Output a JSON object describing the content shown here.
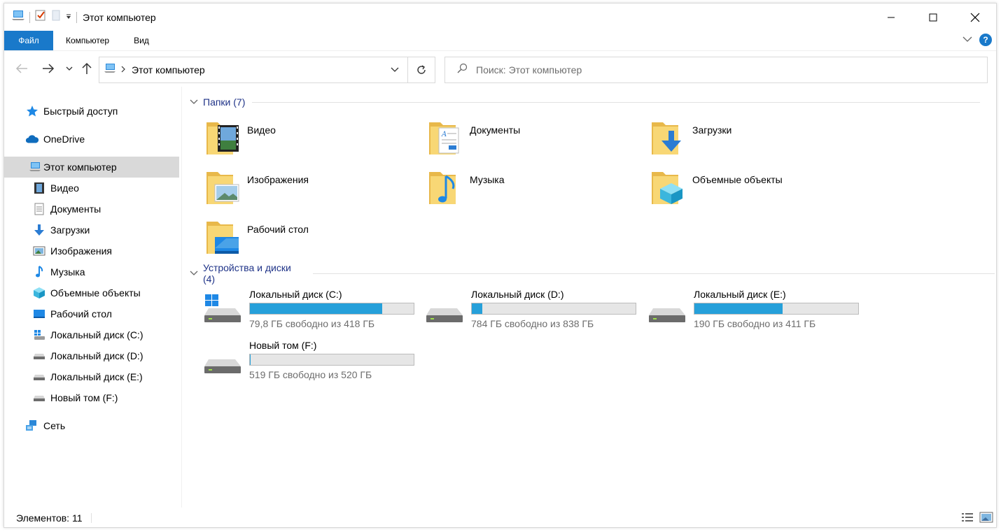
{
  "window": {
    "title": "Этот компьютер",
    "minimize_icon": "minimize-icon",
    "maximize_icon": "maximize-icon",
    "close_icon": "close-icon"
  },
  "ribbon": {
    "tabs": [
      {
        "label": "Файл",
        "active": true
      },
      {
        "label": "Компьютер"
      },
      {
        "label": "Вид"
      }
    ],
    "accent": "#1979ca"
  },
  "address": {
    "path": "Этот компьютер",
    "search_placeholder": "Поиск: Этот компьютер"
  },
  "nav": {
    "items": [
      {
        "label": "Быстрый доступ",
        "icon": "star-icon"
      },
      {
        "label": "OneDrive",
        "icon": "cloud-icon"
      },
      {
        "label": "Этот компьютер",
        "icon": "computer-icon",
        "selected": true
      },
      {
        "label": "Видео",
        "icon": "video-icon"
      },
      {
        "label": "Документы",
        "icon": "document-icon"
      },
      {
        "label": "Загрузки",
        "icon": "download-icon"
      },
      {
        "label": "Изображения",
        "icon": "image-icon"
      },
      {
        "label": "Музыка",
        "icon": "music-icon"
      },
      {
        "label": "Объемные объекты",
        "icon": "cube-icon"
      },
      {
        "label": "Рабочий стол",
        "icon": "desktop-icon"
      },
      {
        "label": "Локальный диск (C:)",
        "icon": "windows-drive-icon"
      },
      {
        "label": "Локальный диск (D:)",
        "icon": "drive-icon"
      },
      {
        "label": "Локальный диск (E:)",
        "icon": "drive-icon"
      },
      {
        "label": "Новый том (F:)",
        "icon": "drive-icon"
      },
      {
        "label": "Сеть",
        "icon": "network-icon"
      }
    ]
  },
  "folders": {
    "header": "Папки (7)",
    "items": [
      {
        "label": "Видео",
        "icon": "video-folder-icon"
      },
      {
        "label": "Документы",
        "icon": "documents-folder-icon"
      },
      {
        "label": "Загрузки",
        "icon": "downloads-folder-icon"
      },
      {
        "label": "Изображения",
        "icon": "pictures-folder-icon"
      },
      {
        "label": "Музыка",
        "icon": "music-folder-icon"
      },
      {
        "label": "Объемные объекты",
        "icon": "3d-objects-folder-icon"
      },
      {
        "label": "Рабочий стол",
        "icon": "desktop-folder-icon"
      }
    ]
  },
  "drives": {
    "header": "Устройства и диски (4)",
    "items": [
      {
        "label": "Локальный диск (C:)",
        "free": "79,8 ГБ свободно из 418 ГБ",
        "used_fraction": 0.809
      },
      {
        "label": "Локальный диск (D:)",
        "free": "784 ГБ свободно из 838 ГБ",
        "used_fraction": 0.064
      },
      {
        "label": "Локальный диск (E:)",
        "free": "190 ГБ свободно из 411 ГБ",
        "used_fraction": 0.538
      },
      {
        "label": "Новый том (F:)",
        "free": "519 ГБ свободно из 520 ГБ",
        "used_fraction": 0.002
      }
    ],
    "bar_color": "#26a0da"
  },
  "status": {
    "items_count": "Элементов: 11"
  }
}
